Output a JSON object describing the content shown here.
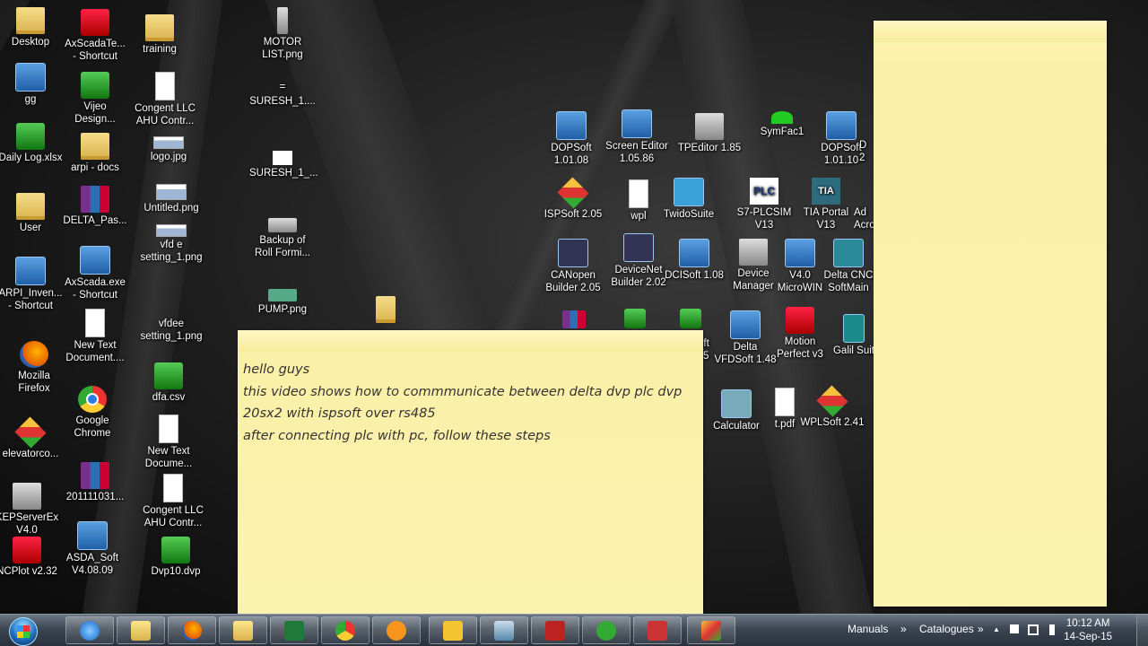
{
  "desktop_icons": [
    {
      "label": "Desktop",
      "icon": "folder-user-icon"
    },
    {
      "label": "AxScadaTe...\n- Shortcut",
      "icon": "axscada-icon"
    },
    {
      "label": "training",
      "icon": "folder-icon"
    },
    {
      "label": "MOTOR\nLIST.png",
      "icon": "image-icon"
    },
    {
      "label": "gg",
      "icon": "network-icon"
    },
    {
      "label": "Vijeo\nDesign...",
      "icon": "vijeo-icon"
    },
    {
      "label": "Congent LLC\nAHU Contr...",
      "icon": "document-icon"
    },
    {
      "label": "SURESH_1....",
      "icon": "image-icon"
    },
    {
      "label": "Daily Log.xlsx",
      "icon": "excel-icon"
    },
    {
      "label": "arpi - docs",
      "icon": "folder-icon"
    },
    {
      "label": "logo.jpg",
      "icon": "image-icon"
    },
    {
      "label": "SURESH_1_...",
      "icon": "image-icon"
    },
    {
      "label": "User",
      "icon": "folder-user-icon"
    },
    {
      "label": "DELTA_Pas...",
      "icon": "winrar-icon"
    },
    {
      "label": "Untitled.png",
      "icon": "image-icon"
    },
    {
      "label": "Backup of\nRoll Formi...",
      "icon": "drive-icon"
    },
    {
      "label": "vfd e\nsetting_1.png",
      "icon": "image-icon"
    },
    {
      "label": "ARPI_Inven...\n- Shortcut",
      "icon": "arpi-icon"
    },
    {
      "label": "AxScada.exe\n- Shortcut",
      "icon": "axscada-icon"
    },
    {
      "label": "PUMP.png",
      "icon": "image-icon"
    },
    {
      "label": "New Text\nDocument....",
      "icon": "document-icon"
    },
    {
      "label": "vfdee\nsetting_1.png",
      "icon": "image-icon"
    },
    {
      "label": "Mozilla\nFirefox",
      "icon": "firefox-icon"
    },
    {
      "label": "dfa.csv",
      "icon": "csv-icon"
    },
    {
      "label": "Google\nChrome",
      "icon": "chrome-icon"
    },
    {
      "label": "New Text\nDocume...",
      "icon": "document-icon"
    },
    {
      "label": "elevatorco...",
      "icon": "cube-icon"
    },
    {
      "label": "201111031...",
      "icon": "winrar-icon"
    },
    {
      "label": "Congent LLC\nAHU Contr...",
      "icon": "document-icon"
    },
    {
      "label": "KEPServerEx\nV4.0",
      "icon": "kepserver-icon"
    },
    {
      "label": "ASDA_Soft\nV4.08.09",
      "icon": "asda-icon"
    },
    {
      "label": "Dvp10.dvp",
      "icon": "dvp-icon"
    },
    {
      "label": "NCPlot v2.32",
      "icon": "cnc-icon"
    },
    {
      "label": "DOPSoft\n1.01.08",
      "icon": "dopsoft-icon"
    },
    {
      "label": "Screen Editor\n1.05.86",
      "icon": "screen-editor-icon"
    },
    {
      "label": "TPEditor 1.85",
      "icon": "tpeditor-icon"
    },
    {
      "label": "SymFac1",
      "icon": "symfac-icon"
    },
    {
      "label": "DOPSoft\n1.01.10",
      "icon": "dopsoft-icon"
    },
    {
      "label": "ISPSoft 2.05",
      "icon": "ispsoft-icon"
    },
    {
      "label": "wpl",
      "icon": "wpl-icon"
    },
    {
      "label": "TwidoSuite",
      "icon": "twido-icon"
    },
    {
      "label": "S7-PLCSIM\nV13",
      "icon": "plcsim-icon"
    },
    {
      "label": "TIA Portal\nV13",
      "icon": "tia-icon"
    },
    {
      "label": "CANopen\nBuilder 2.05",
      "icon": "canopen-icon"
    },
    {
      "label": "DeviceNet\nBuilder 2.02",
      "icon": "devicenet-icon"
    },
    {
      "label": "DCISoft 1.08",
      "icon": "dcisoft-icon"
    },
    {
      "label": "Device\nManager",
      "icon": "device-manager-icon"
    },
    {
      "label": "V4.0\nMicroWIN",
      "icon": "microwin-icon"
    },
    {
      "label": "Delta CNC\nSoftMain",
      "icon": "cnc-softmain-icon"
    },
    {
      "label": "Delta\nVFDSoft 1.48",
      "icon": "vfdsoft-icon"
    },
    {
      "label": "Motion\nPerfect v3",
      "icon": "motion-perfect-icon"
    },
    {
      "label": "Galil Suit",
      "icon": "galil-icon"
    },
    {
      "label": "Calculator",
      "icon": "calculator-icon"
    },
    {
      "label": "t.pdf",
      "icon": "pdf-icon"
    },
    {
      "label": "WPLSoft 2.41",
      "icon": "wplsoft-icon"
    }
  ],
  "partial_icons": {
    "a": "D",
    "b": "2",
    "c": "Ad",
    "d": "Acro",
    "e": "oft",
    "f": "5"
  },
  "sticky_note_main": {
    "lines": [
      "hello guys",
      "this video shows how to commmunicate between delta dvp plc dvp",
      "20sx2 with ispsoft over rs485",
      "after connecting plc with pc, follow these steps"
    ]
  },
  "sticky_note_right": {
    "text": ""
  },
  "taskbar": {
    "apps": [
      "start-button",
      "internet-explorer",
      "windows-explorer-libraries",
      "firefox",
      "windows-explorer",
      "excel",
      "chrome",
      "media-player",
      "outlook",
      "picture-viewer",
      "sticky-notes",
      "evernote",
      "arpi",
      "cube-app"
    ],
    "toolbars": [
      "Manuals",
      "Catalogues"
    ],
    "toolbar_arrow": "»",
    "tray_arrow": "▲",
    "clock_time": "10:12 AM",
    "clock_date": "14-Sep-15"
  }
}
